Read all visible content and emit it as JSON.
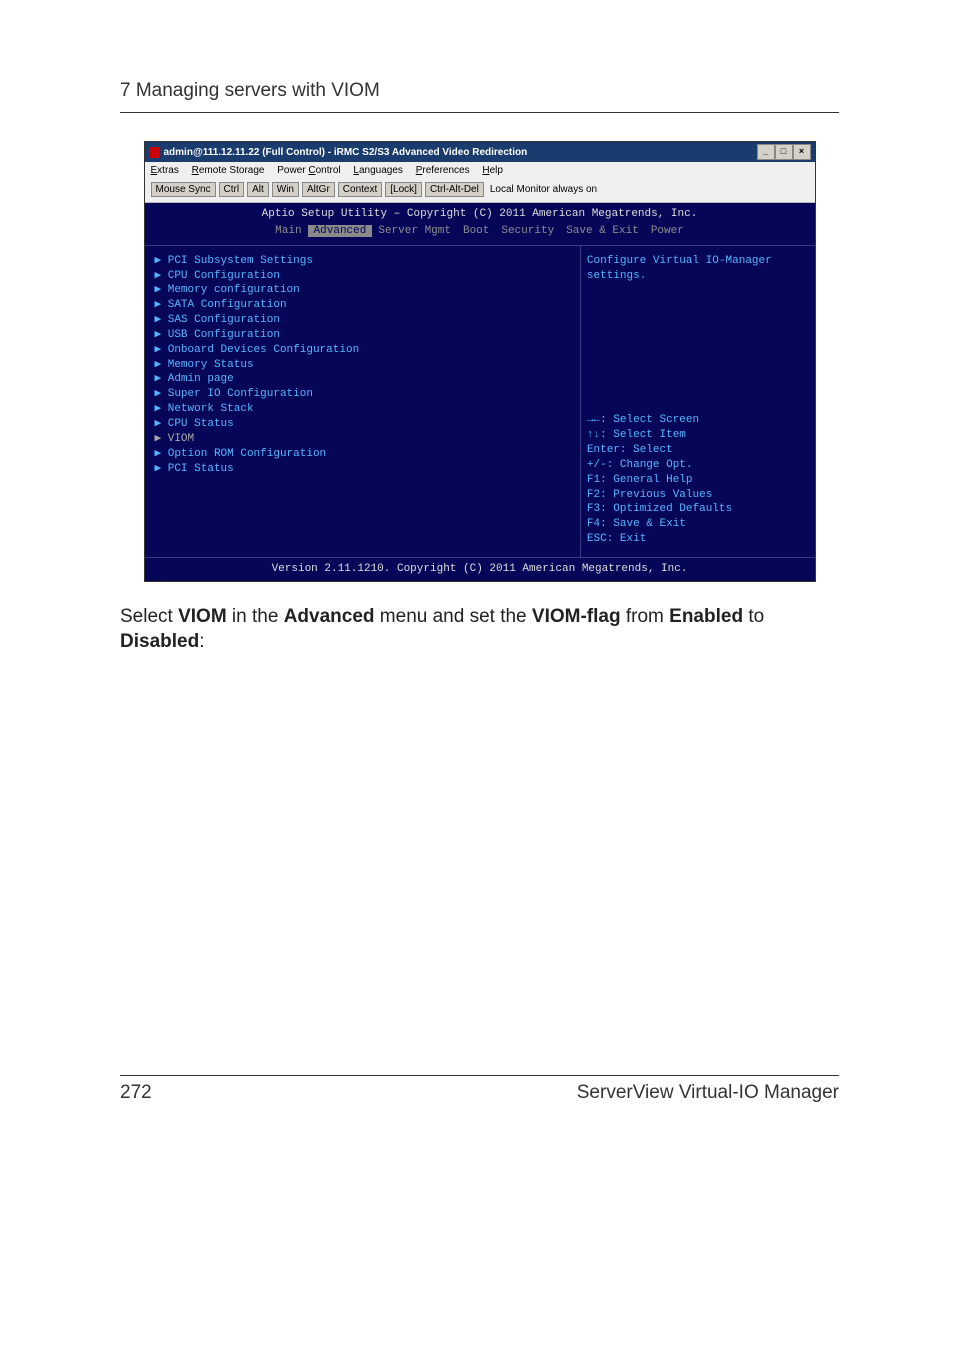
{
  "header": {
    "chapter": "7 Managing servers with VIOM"
  },
  "window": {
    "title": "admin@111.12.11.22 (Full Control) - iRMC S2/S3 Advanced Video Redirection",
    "menubar": {
      "extras": "Extras",
      "remote_storage": "Remote Storage",
      "power_control": "Power Control",
      "languages": "Languages",
      "preferences": "Preferences",
      "help": "Help"
    },
    "toolbar": {
      "mouse_sync": "Mouse Sync",
      "ctrl": "Ctrl",
      "alt": "Alt",
      "win": "Win",
      "altgr": "AltGr",
      "context": "Context",
      "lock": "[Lock]",
      "cad": "Ctrl-Alt-Del",
      "lma": "Local Monitor always on"
    }
  },
  "bios": {
    "header_line": "Aptio Setup Utility – Copyright (C) 2011 American Megatrends, Inc.",
    "tabs": {
      "main": "Main",
      "advanced": "Advanced",
      "server_mgmt": "Server Mgmt",
      "boot": "Boot",
      "security": "Security",
      "save_exit": "Save & Exit",
      "power": "Power"
    },
    "menu": {
      "pci_subsystem": "PCI Subsystem Settings",
      "cpu_config": "CPU Configuration",
      "memory_config": "Memory configuration",
      "sata_config": "SATA Configuration",
      "sas_config": "SAS Configuration",
      "usb_config": "USB Configuration",
      "onboard_devices": "Onboard Devices Configuration",
      "memory_status": "Memory Status",
      "admin_page": "Admin page",
      "super_io": "Super IO Configuration",
      "network_stack": "Network Stack",
      "cpu_status": "CPU Status",
      "viom": "VIOM",
      "option_rom": "Option ROM Configuration",
      "pci_status": "PCI Status"
    },
    "help_text": "Configure Virtual IO-Manager settings.",
    "keys": {
      "select_screen": "→←: Select Screen",
      "select_item": "↑↓: Select Item",
      "enter": "Enter: Select",
      "change": "+/-: Change Opt.",
      "f1": "F1: General Help",
      "f2": "F2: Previous Values",
      "f3": "F3: Optimized Defaults",
      "f4": "F4: Save & Exit",
      "esc": "ESC: Exit"
    },
    "footer": "Version 2.11.1210. Copyright (C) 2011 American Megatrends, Inc."
  },
  "body_text": {
    "pre": "Select ",
    "b1": "VIOM",
    "mid1": " in the ",
    "b2": "Advanced",
    "mid2": " menu and set the ",
    "b3": "VIOM-flag",
    "mid3": " from ",
    "b4": "Enabled",
    "mid4": " to ",
    "b5": "Disabled",
    "end": ":"
  },
  "footer": {
    "page_number": "272",
    "product": "ServerView Virtual-IO Manager"
  }
}
